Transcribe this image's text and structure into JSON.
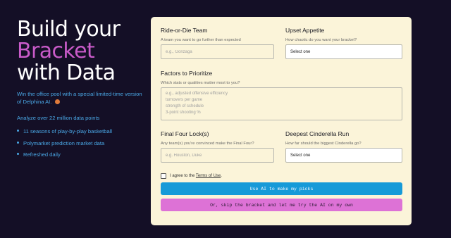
{
  "hero": {
    "line1": "Build your",
    "line2": "Bracket",
    "line3": "with Data",
    "subtitle": "Win the office pool with a special limited-time version of Delphina AI.",
    "subtitle_icon": "basketball-icon",
    "stat_lead": "Analyze over 22 million data points",
    "bullets": [
      "11 seasons of play-by-play basketball",
      "Polymarket prediction market data",
      "Refreshed daily"
    ]
  },
  "form": {
    "ride_or_die": {
      "label": "Ride-or-Die Team",
      "hint": "A team you want to go further than expected",
      "placeholder": "e.g., Gonzaga"
    },
    "upset_appetite": {
      "label": "Upset Appetite",
      "hint": "How chaotic do you want your bracket?",
      "value": "Select one"
    },
    "factors": {
      "label": "Factors to Prioritize",
      "hint": "Which stats or qualities matter most to you?",
      "placeholder_lines": [
        "e.g., adjusted offensive efficiency",
        "turnovers per game",
        "strength of schedule",
        "3-point shooting %"
      ]
    },
    "final_four": {
      "label": "Final Four Lock(s)",
      "hint": "Any team(s) you're convinced make the Final Four?",
      "placeholder": "e.g. Houston, Duke"
    },
    "cinderella": {
      "label": "Deepest Cinderella Run",
      "hint": "How far should the biggest Cinderella go?",
      "value": "Select one"
    },
    "terms": {
      "prefix": "I agree to the ",
      "link": "Terms of Use",
      "suffix": "."
    },
    "primary_button": "Use AI to make my picks",
    "secondary_button": "Or, skip the bracket and let me try the AI on my own"
  },
  "colors": {
    "background": "#140f26",
    "card": "#fbf4d9",
    "accent_pink": "#c95bc9",
    "accent_blue": "#4aa8e6",
    "primary_button": "#169ad8",
    "secondary_button": "#dd72d6"
  }
}
